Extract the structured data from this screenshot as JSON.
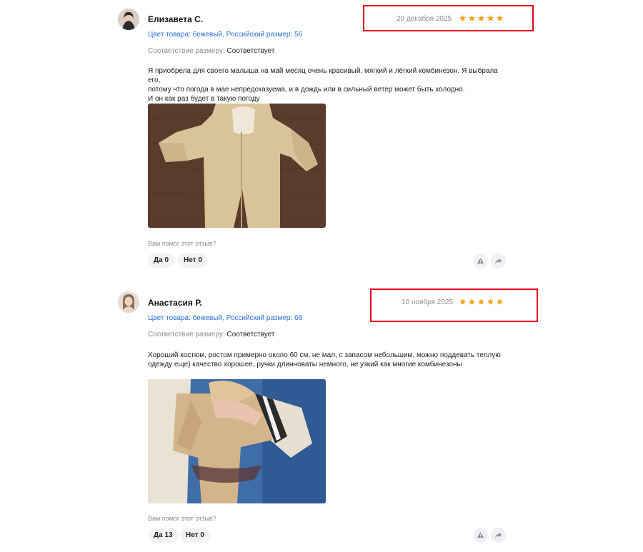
{
  "reviews": [
    {
      "author": "Елизавета С.",
      "date": "20 декабря 2025",
      "rating": 5,
      "product_line": "Цвет товара: бежевый, Российский размер: 56",
      "fit_label": "Соответствие размеру:",
      "fit_value": "Соответствует",
      "text_lines": [
        "Я приобрела для своего малыша на май месяц очень красивый, мягкий и лёгкий комбинезон. Я выбрала его,",
        "потому что погода в мае непредсказуема, и в дождь или в сильный ветер может быть холодно.",
        "И он как раз будет в такую погоду"
      ],
      "helpful_question": "Вам помог этот отзыв?",
      "yes_label": "Да 0",
      "no_label": "Нет 0"
    },
    {
      "author": "Анастасия Р.",
      "date": "10 ноября 2025",
      "rating": 5,
      "product_line": "Цвет товара: бежевый, Российский размер: 68",
      "fit_label": "Соответствие размеру:",
      "fit_value": "Соответствует",
      "text_lines": [
        "Хороший костюм, ростом примерно около 60 см, не мал, с запасом небольшим, можно поддевать теплую",
        "одежду еще) качество хорошее, ручки длинноваты немного, не узкий как многие комбинезоны"
      ],
      "helpful_question": "Вам помог этот отзыв?",
      "yes_label": "Да 13",
      "no_label": "Нет 0"
    }
  ],
  "icons": {
    "star": "star-icon",
    "report": "warning-icon",
    "share": "share-icon"
  },
  "colors": {
    "star": "#f7a21b",
    "link": "#2a6fd6",
    "highlight_box": "#e3061b",
    "muted": "#8b8b95"
  }
}
